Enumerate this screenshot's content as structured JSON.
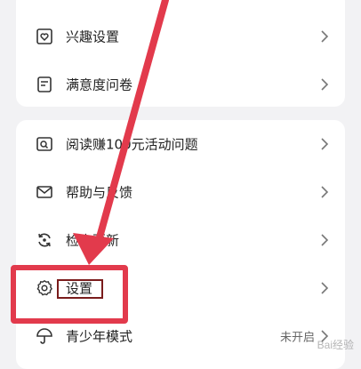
{
  "menu": {
    "group1": [
      {
        "label": "兴趣设置",
        "icon": "heart-in-box-icon"
      },
      {
        "label": "满意度问卷",
        "icon": "document-icon"
      }
    ],
    "group2": [
      {
        "label": "阅读赚100元活动问题",
        "icon": "search-box-icon"
      },
      {
        "label": "帮助与反馈",
        "icon": "mail-icon"
      },
      {
        "label": "检查更新",
        "icon": "refresh-icon"
      },
      {
        "label": "设置",
        "icon": "gear-icon"
      },
      {
        "label": "青少年模式",
        "icon": "umbrella-icon",
        "status": "未开启"
      }
    ]
  },
  "colors": {
    "annotation": "#e23a4c",
    "annotation_inner": "#7a1c1c"
  },
  "watermark": "Bai经验"
}
